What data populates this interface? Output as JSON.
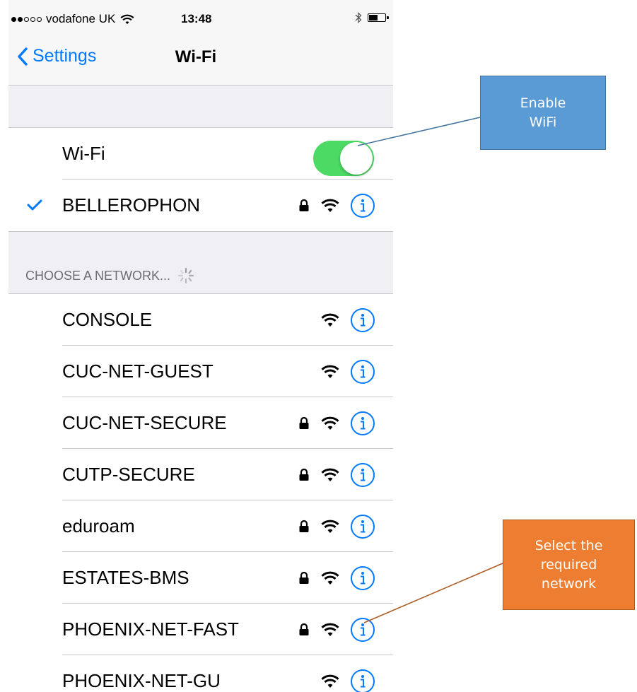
{
  "status_bar": {
    "carrier": "vodafone UK",
    "time": "13:48",
    "signal_bars_filled": 2,
    "signal_bars_total": 5
  },
  "nav": {
    "back_label": "Settings",
    "title": "Wi-Fi"
  },
  "wifi_toggle": {
    "label": "Wi-Fi",
    "on": true
  },
  "connected_network": {
    "name": "BELLEROPHON",
    "secured": true
  },
  "choose_header": "CHOOSE A NETWORK...",
  "networks": [
    {
      "name": "CONSOLE",
      "secured": false
    },
    {
      "name": "CUC-NET-GUEST",
      "secured": false
    },
    {
      "name": "CUC-NET-SECURE",
      "secured": true
    },
    {
      "name": "CUTP-SECURE",
      "secured": true
    },
    {
      "name": "eduroam",
      "secured": true
    },
    {
      "name": "ESTATES-BMS",
      "secured": true
    },
    {
      "name": "PHOENIX-NET-FAST",
      "secured": true
    },
    {
      "name": "PHOENIX-NET-GU",
      "secured": false
    }
  ],
  "callouts": {
    "enable": {
      "line1": "Enable",
      "line2": "WiFi",
      "color": "#5b9bd5"
    },
    "select": {
      "line1": "Select the",
      "line2": "required",
      "line3": "network",
      "color": "#ed7d31"
    }
  },
  "colors": {
    "ios_blue": "#007aff",
    "toggle_green": "#4cd964"
  }
}
